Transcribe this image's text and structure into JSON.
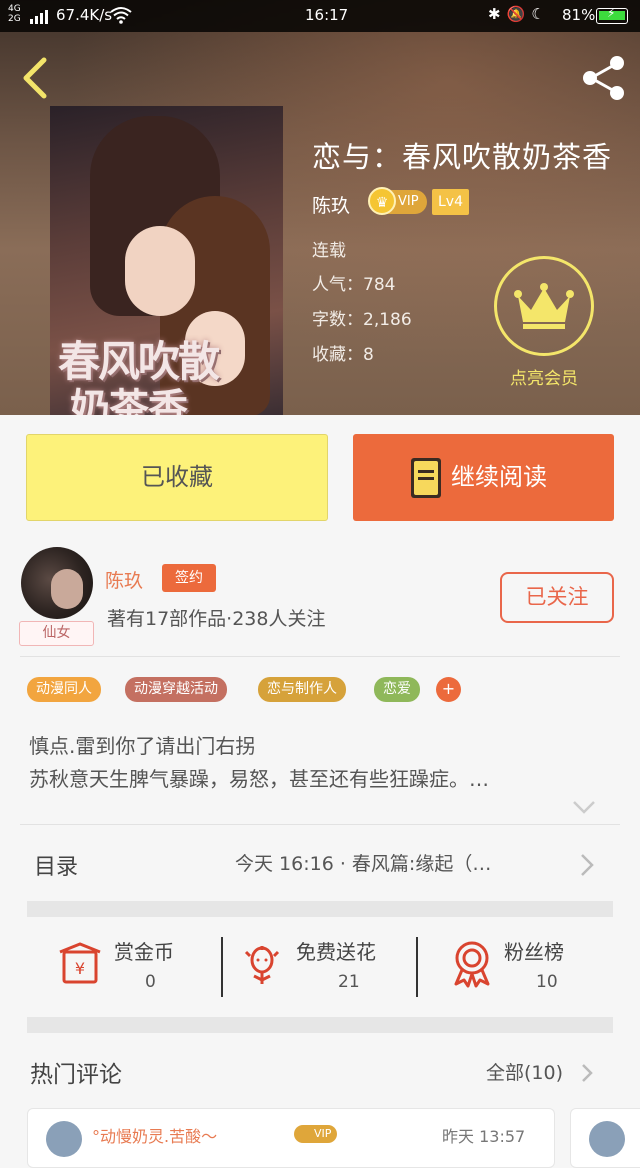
{
  "status_bar": {
    "network": "4G\n2G",
    "speed": "67.4K/s",
    "time": "16:17",
    "battery_text": "81%",
    "battery_level": 0.81
  },
  "book": {
    "title": "恋与：春风吹散奶茶香",
    "cover_title_line1": "春风吹散",
    "cover_title_line2": "奶茶香",
    "author": "陈玖",
    "vip": "VIP",
    "level": "Lv4",
    "status": "连载",
    "popularity": "人气：784",
    "words": "字数：2,186",
    "favorites": "收藏：8"
  },
  "member": {
    "label": "点亮会员"
  },
  "actions": {
    "collected": "已收藏",
    "continue_reading": "继续阅读"
  },
  "author": {
    "name": "陈玖",
    "signed": "签约",
    "avatar_tag": "仙女",
    "info": "著有17部作品·238人关注",
    "follow": "已关注"
  },
  "tags": [
    "动漫同人",
    "动漫穿越活动",
    "恋与制作人",
    "恋爱"
  ],
  "tag_add": "+",
  "summary": {
    "line1": "慎点.雷到你了请出门右拐",
    "line2": "苏秋意天生脾气暴躁，易怒，甚至还有些狂躁症。…"
  },
  "toc": {
    "label": "目录",
    "latest": "今天 16:16 · 春风篇:缘起（…"
  },
  "stats": [
    {
      "label": "赏金币",
      "value": "0",
      "icon": "red-envelope-icon"
    },
    {
      "label": "免费送花",
      "value": "21",
      "icon": "flower-icon"
    },
    {
      "label": "粉丝榜",
      "value": "10",
      "icon": "medal-icon"
    }
  ],
  "comments": {
    "title": "热门评论",
    "all": "全部(10)",
    "first_name": "°动慢奶灵.苦酸～",
    "first_vip": "VIP",
    "first_time": "昨天 13:57"
  },
  "colors": {
    "accent_orange": "#ec6a3c",
    "collect_yellow": "#fdf27a",
    "member_yellow": "#f4e66a",
    "vip_gold": "#dfa63a"
  }
}
